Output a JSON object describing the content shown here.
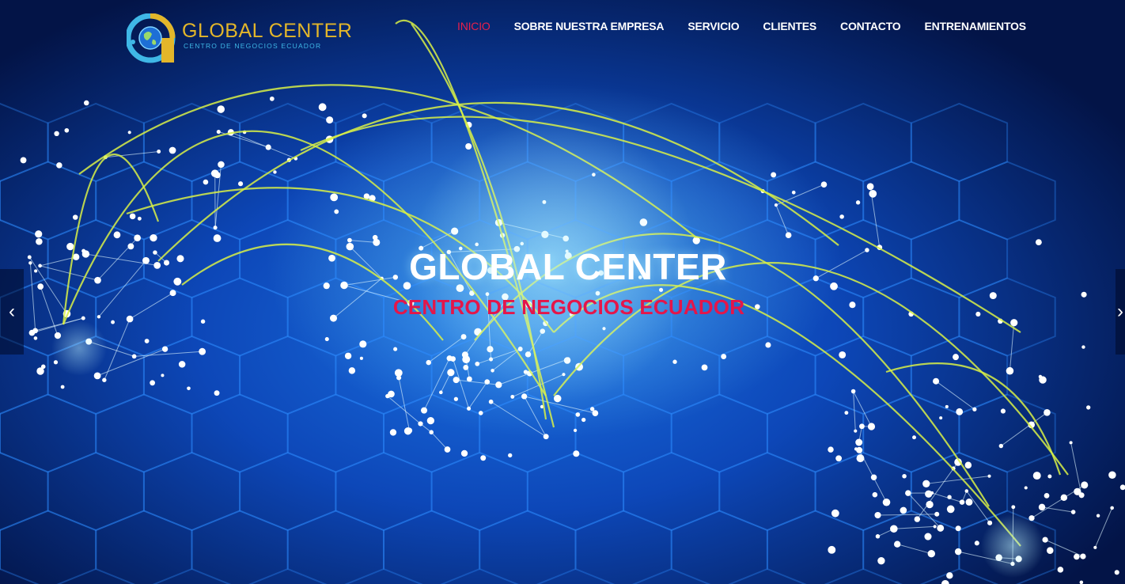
{
  "logo": {
    "title": "GLOBAL CENTER",
    "subtitle": "CENTRO DE NEGOCIOS ECUADOR",
    "icon": "globe-g-icon"
  },
  "nav": {
    "items": [
      {
        "label": "INICIO",
        "active": true
      },
      {
        "label": "SOBRE NUESTRA EMPRESA",
        "active": false
      },
      {
        "label": "SERVICIO",
        "active": false
      },
      {
        "label": "CLIENTES",
        "active": false
      },
      {
        "label": "CONTACTO",
        "active": false
      },
      {
        "label": "ENTRENAMIENTOS",
        "active": false
      }
    ]
  },
  "slider": {
    "title": "GLOBAL CENTER",
    "subtitle": "CENTRO DE NEGOCIOS ECUADOR",
    "prev_icon": "chevron-left-icon",
    "next_icon": "chevron-right-icon",
    "prev_glyph": "‹",
    "next_glyph": "›"
  },
  "colors": {
    "active_nav": "#e8204a",
    "logo_gold": "#e3b62a",
    "logo_blue": "#3fb7e6",
    "subtitle_red": "#e4164a"
  }
}
